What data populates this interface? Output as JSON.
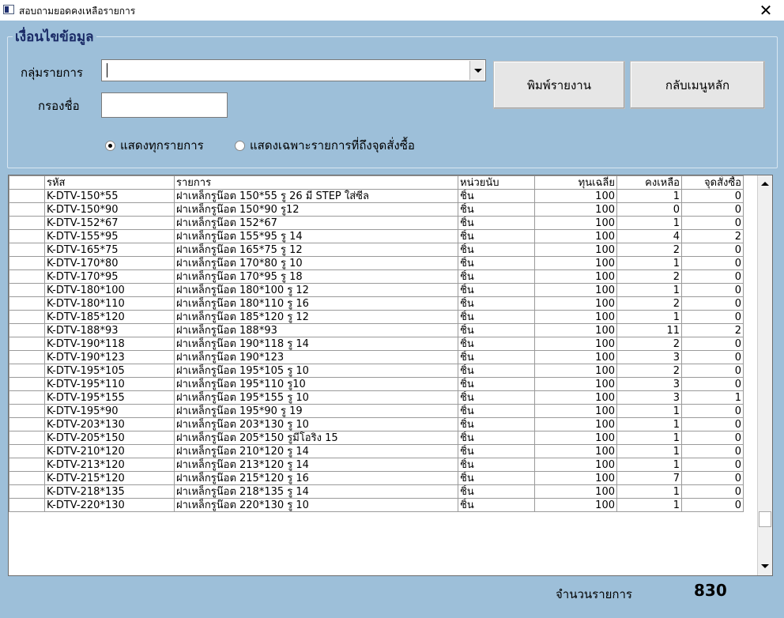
{
  "window": {
    "title": "สอบถามยอดคงเหลือรายการ",
    "close_label": "✕"
  },
  "filters": {
    "legend": "เงื่อนไขข้อมูล",
    "group_label": "กลุ่มรายการ",
    "group_value": "",
    "name_filter_label": "กรองชื่อ",
    "name_filter_value": "",
    "radio_all_label": "แสดงทุกรายการ",
    "radio_reorder_label": "แสดงเฉพาะรายการที่ถึงจุดสั่งซื้อ",
    "selected_radio": "all"
  },
  "buttons": {
    "print_label": "พิมพ์รายงาน",
    "back_label": "กลับเมนูหลัก"
  },
  "table": {
    "columns": [
      "รหัส",
      "รายการ",
      "หน่วยนับ",
      "ทุนเฉลี่ย",
      "คงเหลือ",
      "จุดสั่งซื้อ"
    ],
    "rows": [
      [
        "K-DTV-150*55",
        "ฝาเหล็กรูน๊อต 150*55 รู 26 มี STEP ใส่ซีล",
        "ชิ้น",
        "100",
        "1",
        "0"
      ],
      [
        "K-DTV-150*90",
        "ฝาเหล็กรูน๊อต 150*90 รู12",
        "ชิ้น",
        "100",
        "0",
        "0"
      ],
      [
        "K-DTV-152*67",
        "ฝาเหล็กรูน๊อต 152*67",
        "ชิ้น",
        "100",
        "1",
        "0"
      ],
      [
        "K-DTV-155*95",
        "ฝาเหล็กรูน๊อต 155*95 รู 14",
        "ชิ้น",
        "100",
        "4",
        "2"
      ],
      [
        "K-DTV-165*75",
        "ฝาเหล็กรูน๊อต 165*75 รู 12",
        "ชิ้น",
        "100",
        "2",
        "0"
      ],
      [
        "K-DTV-170*80",
        "ฝาเหล็กรูน๊อต 170*80 รู 10",
        "ชิ้น",
        "100",
        "1",
        "0"
      ],
      [
        "K-DTV-170*95",
        "ฝาเหล็กรูน๊อต 170*95 รู 18",
        "ชิ้น",
        "100",
        "2",
        "0"
      ],
      [
        "K-DTV-180*100",
        "ฝาเหล็กรูน๊อต 180*100 รู 12",
        "ชิ้น",
        "100",
        "1",
        "0"
      ],
      [
        "K-DTV-180*110",
        "ฝาเหล็กรูน๊อต 180*110 รู 16",
        "ชิ้น",
        "100",
        "2",
        "0"
      ],
      [
        "K-DTV-185*120",
        "ฝาเหล็กรูน๊อต 185*120 รู 12",
        "ชิ้น",
        "100",
        "1",
        "0"
      ],
      [
        "K-DTV-188*93",
        "ฝาเหล็กรูน๊อต 188*93",
        "ชิ้น",
        "100",
        "11",
        "2"
      ],
      [
        "K-DTV-190*118",
        "ฝาเหล็กรูน๊อต 190*118 รู 14",
        "ชิ้น",
        "100",
        "2",
        "0"
      ],
      [
        "K-DTV-190*123",
        "ฝาเหล็กรูน๊อต 190*123",
        "ชิ้น",
        "100",
        "3",
        "0"
      ],
      [
        "K-DTV-195*105",
        "ฝาเหล็กรูน๊อต 195*105 รู 10",
        "ชิ้น",
        "100",
        "2",
        "0"
      ],
      [
        "K-DTV-195*110",
        "ฝาเหล็กรูน๊อต 195*110 รู10",
        "ชิ้น",
        "100",
        "3",
        "0"
      ],
      [
        "K-DTV-195*155",
        "ฝาเหล็กรูน๊อต 195*155 รู 10",
        "ชิ้น",
        "100",
        "3",
        "1"
      ],
      [
        "K-DTV-195*90",
        "ฝาเหล็กรูน๊อต 195*90 รู 19",
        "ชิ้น",
        "100",
        "1",
        "0"
      ],
      [
        "K-DTV-203*130",
        "ฝาเหล็กรูน๊อต 203*130 รู 10",
        "ชิ้น",
        "100",
        "1",
        "0"
      ],
      [
        "K-DTV-205*150",
        "ฝาเหล็กรูน๊อต 205*150 รูมีโอริง 15",
        "ชิ้น",
        "100",
        "1",
        "0"
      ],
      [
        "K-DTV-210*120",
        "ฝาเหล็กรูน๊อต 210*120 รู 14",
        "ชิ้น",
        "100",
        "1",
        "0"
      ],
      [
        "K-DTV-213*120",
        "ฝาเหล็กรูน๊อต 213*120 รู 14",
        "ชิ้น",
        "100",
        "1",
        "0"
      ],
      [
        "K-DTV-215*120",
        "ฝาเหล็กรูน๊อต 215*120 รู 16",
        "ชิ้น",
        "100",
        "7",
        "0"
      ],
      [
        "K-DTV-218*135",
        "ฝาเหล็กรูน๊อต 218*135 รู 14",
        "ชิ้น",
        "100",
        "1",
        "0"
      ],
      [
        "K-DTV-220*130",
        "ฝาเหล็กรูน๊อต 220*130 รู 10",
        "ชิ้น",
        "100",
        "1",
        "0"
      ]
    ]
  },
  "footer": {
    "count_label": "จำนวนรายการ",
    "count_value": "830"
  }
}
